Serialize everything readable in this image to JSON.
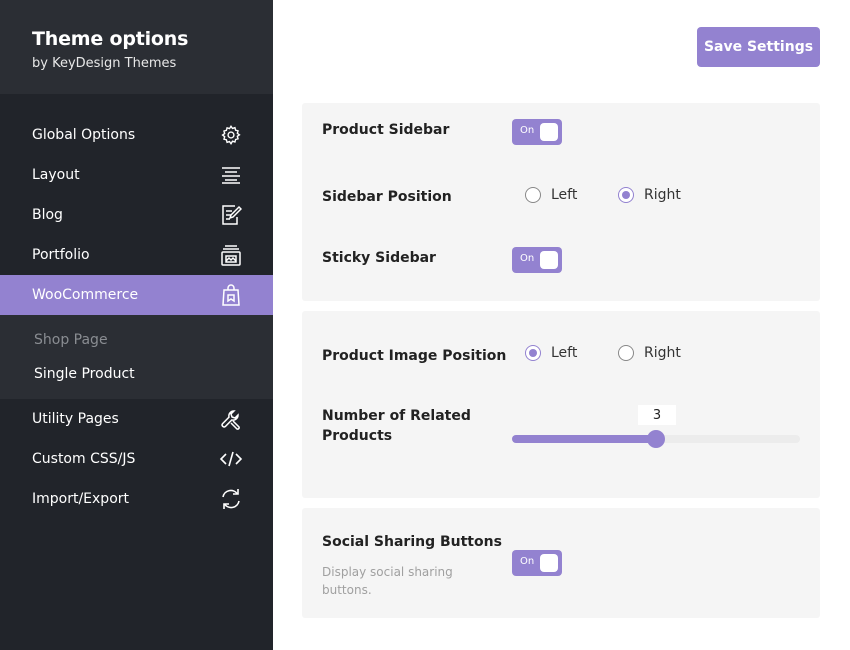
{
  "sidebar": {
    "title": "Theme options",
    "subtitle": "by KeyDesign Themes",
    "items": [
      {
        "label": "Global Options",
        "icon": "gear-icon"
      },
      {
        "label": "Layout",
        "icon": "align-lines-icon"
      },
      {
        "label": "Blog",
        "icon": "edit-document-icon"
      },
      {
        "label": "Portfolio",
        "icon": "image-stack-icon"
      },
      {
        "label": "WooCommerce",
        "icon": "shopping-bag-icon",
        "active": true
      }
    ],
    "subitems": [
      {
        "label": "Shop Page",
        "active": false
      },
      {
        "label": "Single Product",
        "active": true
      }
    ],
    "items_after": [
      {
        "label": "Utility Pages",
        "icon": "wrench-icon"
      },
      {
        "label": "Custom CSS/JS",
        "icon": "code-icon"
      },
      {
        "label": "Import/Export",
        "icon": "sync-icon"
      }
    ]
  },
  "toolbar": {
    "save_label": "Save Settings"
  },
  "settings": {
    "product_sidebar": {
      "label": "Product Sidebar",
      "toggle_text": "On",
      "value": true
    },
    "sidebar_position": {
      "label": "Sidebar Position",
      "options": [
        "Left",
        "Right"
      ],
      "selected": "Right"
    },
    "sticky_sidebar": {
      "label": "Sticky Sidebar",
      "toggle_text": "On",
      "value": true
    },
    "product_image_position": {
      "label": "Product Image Position",
      "options": [
        "Left",
        "Right"
      ],
      "selected": "Left"
    },
    "related_products": {
      "label_line1": "Number of Related",
      "label_line2": "Products",
      "value": "3",
      "fraction": 0.5
    },
    "social_sharing": {
      "label": "Social Sharing Buttons",
      "desc_line1": "Display social sharing",
      "desc_line2": "buttons.",
      "toggle_text": "On",
      "value": true
    }
  },
  "colors": {
    "accent": "#9382d0",
    "sidebar_bg": "#21242a",
    "sidebar_header_bg": "#2b2e34",
    "panel_bg": "#f5f5f5"
  }
}
